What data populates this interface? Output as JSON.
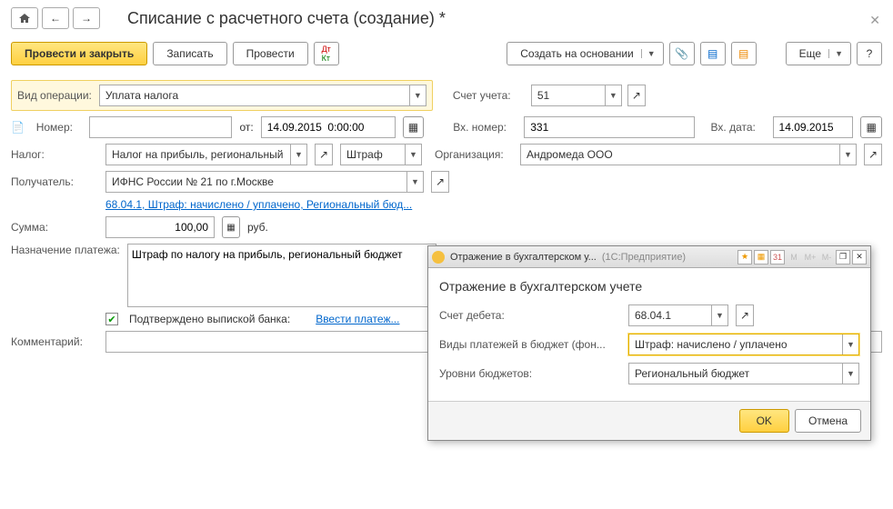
{
  "title": "Списание с расчетного счета (создание) *",
  "toolbar": {
    "postAndClose": "Провести и закрыть",
    "save": "Записать",
    "post": "Провести",
    "createBased": "Создать на основании",
    "more": "Еще"
  },
  "labels": {
    "opType": "Вид операции:",
    "account": "Счет учета:",
    "number": "Номер:",
    "from": "от:",
    "extNumber": "Вх. номер:",
    "extDate": "Вх. дата:",
    "tax": "Налог:",
    "org": "Организация:",
    "recipient": "Получатель:",
    "sum": "Сумма:",
    "currency": "руб.",
    "purpose": "Назначение платежа:",
    "confirmed": "Подтверждено выпиской банка:",
    "enterPayment": "Ввести платеж...",
    "comment": "Комментарий:"
  },
  "values": {
    "opType": "Уплата налога",
    "account": "51",
    "date": "14.09.2015  0:00:00",
    "extNumber": "331",
    "extDate": "14.09.2015",
    "tax": "Налог на прибыль, региональный",
    "taxKind": "Штраф",
    "org": "Андромеда ООО",
    "recipient": "ИФНС России № 21 по г.Москве",
    "accountingLink": "68.04.1, Штраф: начислено / уплачено, Региональный бюд...",
    "sum": "100,00",
    "purpose": "Штраф по налогу на прибыль, региональный бюджет"
  },
  "dialog": {
    "winTitle": "Отражение в бухгалтерском у...",
    "appName": "(1С:Предприятие)",
    "heading": "Отражение в бухгалтерском учете",
    "labels": {
      "debit": "Счет дебета:",
      "payKind": "Виды платежей в бюджет (фон...",
      "budget": "Уровни бюджетов:"
    },
    "values": {
      "debit": "68.04.1",
      "payKind": "Штраф: начислено / уплачено",
      "budget": "Региональный бюджет"
    },
    "ok": "OK",
    "cancel": "Отмена"
  }
}
